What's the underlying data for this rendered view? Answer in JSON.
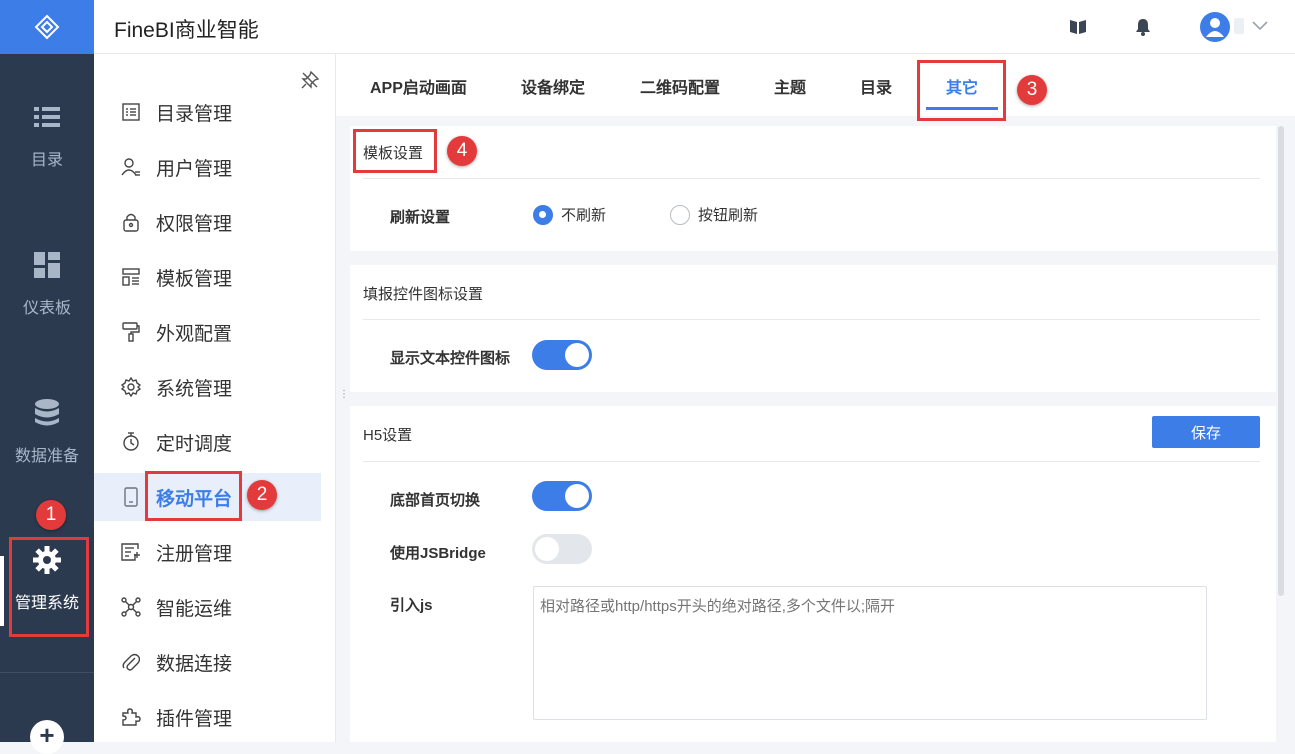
{
  "app": {
    "title": "FineBI商业智能"
  },
  "colors": {
    "accent": "#3d7de8",
    "rail": "#2b3a4f",
    "annotation": "#e33b3b"
  },
  "rail": {
    "items": [
      {
        "label": "目录",
        "icon": "list-icon"
      },
      {
        "label": "仪表板",
        "icon": "dashboard-icon"
      },
      {
        "label": "数据准备",
        "icon": "database-icon"
      },
      {
        "label": "管理系统",
        "icon": "gear-icon",
        "active": true
      }
    ],
    "add_icon": "plus-icon"
  },
  "header": {
    "icons": [
      "book-icon",
      "bell-icon",
      "user-avatar-icon",
      "chevron-down-icon"
    ]
  },
  "subnav": {
    "items": [
      {
        "label": "目录管理",
        "icon": "catalog-icon"
      },
      {
        "label": "用户管理",
        "icon": "user-icon"
      },
      {
        "label": "权限管理",
        "icon": "lock-icon"
      },
      {
        "label": "模板管理",
        "icon": "template-icon"
      },
      {
        "label": "外观配置",
        "icon": "brush-icon"
      },
      {
        "label": "系统管理",
        "icon": "gear-icon"
      },
      {
        "label": "定时调度",
        "icon": "timer-icon"
      },
      {
        "label": "移动平台",
        "icon": "mobile-icon",
        "active": true
      },
      {
        "label": "注册管理",
        "icon": "register-icon"
      },
      {
        "label": "智能运维",
        "icon": "ops-icon"
      },
      {
        "label": "数据连接",
        "icon": "paperclip-icon"
      },
      {
        "label": "插件管理",
        "icon": "puzzle-icon"
      }
    ]
  },
  "tabs": [
    {
      "label": "APP启动画面"
    },
    {
      "label": "设备绑定"
    },
    {
      "label": "二维码配置"
    },
    {
      "label": "主题"
    },
    {
      "label": "目录"
    },
    {
      "label": "其它",
      "active": true
    }
  ],
  "template_settings": {
    "title": "模板设置",
    "refresh_label": "刷新设置",
    "options": [
      {
        "label": "不刷新",
        "checked": true
      },
      {
        "label": "按钮刷新",
        "checked": false
      }
    ]
  },
  "fill_widget_settings": {
    "title": "填报控件图标设置",
    "show_text_icon_label": "显示文本控件图标",
    "show_text_icon_on": true
  },
  "h5_settings": {
    "title": "H5设置",
    "save_label": "保存",
    "bottom_home_label": "底部首页切换",
    "bottom_home_on": true,
    "jsbridge_label": "使用JSBridge",
    "jsbridge_on": false,
    "import_js_label": "引入js",
    "import_js_placeholder": "相对路径或http/https开头的绝对路径,多个文件以;隔开",
    "import_js_value": ""
  },
  "annotations": [
    "1",
    "2",
    "3",
    "4"
  ]
}
